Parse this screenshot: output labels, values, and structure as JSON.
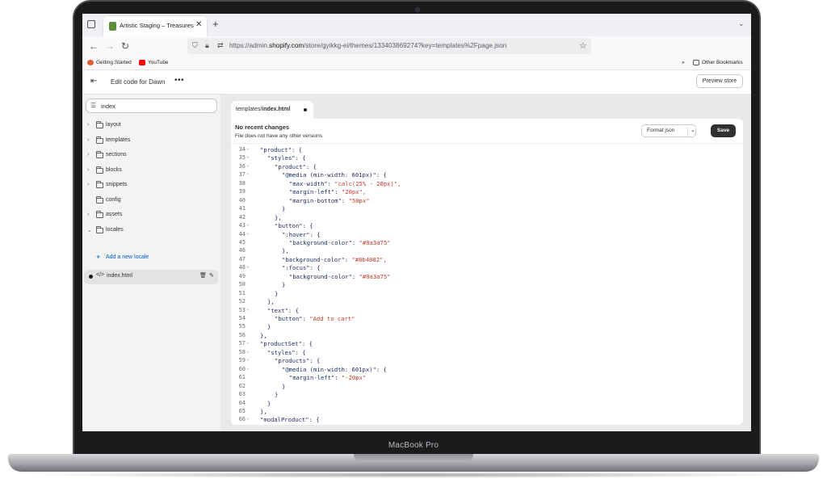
{
  "device": {
    "label": "MacBook Pro"
  },
  "browser": {
    "tab_title": "Artistic Staging – Treasures Stor",
    "url_prefix": "https://admin.",
    "url_host": "shopify.com",
    "url_path": "/store/gyikkg-ei/themes/133403869274?key=templates%2Fpage.json",
    "bookmarks": [
      "Getting Started",
      "YouTube"
    ],
    "other_bookmarks": "Other Bookmarks"
  },
  "header": {
    "title": "Edit code for Dawn",
    "preview_label": "Preview store"
  },
  "sidebar": {
    "search_value": "index",
    "items": [
      {
        "label": "layout",
        "expand": "›"
      },
      {
        "label": "templates",
        "expand": "›"
      },
      {
        "label": "sections",
        "expand": "›"
      },
      {
        "label": "blocks",
        "expand": "›"
      },
      {
        "label": "snippets",
        "expand": "›"
      },
      {
        "label": "config",
        "expand": ""
      },
      {
        "label": "assets",
        "expand": "›"
      },
      {
        "label": "locales",
        "expand": "⌄"
      }
    ],
    "add_locale": "Add a new locale",
    "open_file": "index.html"
  },
  "editor": {
    "tab_prefix": "templates/",
    "tab_file": "index.html",
    "status_title": "No recent changes",
    "status_sub": "File does not have any other versions",
    "format_label": "Format json",
    "save_label": "Save",
    "lines": [
      {
        "n": "34",
        "f": true,
        "t": "\"product\": {",
        "i": 1
      },
      {
        "n": "35",
        "f": true,
        "t": "\"styles\": {",
        "i": 2
      },
      {
        "n": "36",
        "f": true,
        "t": "\"product\": {",
        "i": 3
      },
      {
        "n": "37",
        "f": true,
        "t": "\"@media (min-width: 601px)\": {",
        "i": 4
      },
      {
        "n": "38",
        "f": false,
        "k": "\"max-width\": ",
        "v": "\"calc(25% - 20px)\",",
        "i": 5
      },
      {
        "n": "39",
        "f": false,
        "k": "\"margin-left\": ",
        "v": "\"20px\",",
        "i": 5
      },
      {
        "n": "40",
        "f": false,
        "k": "\"margin-bottom\": ",
        "v": "\"50px\"",
        "i": 5
      },
      {
        "n": "41",
        "f": false,
        "t": "}",
        "i": 4
      },
      {
        "n": "42",
        "f": false,
        "t": "},",
        "i": 3
      },
      {
        "n": "43",
        "f": true,
        "t": "\"button\": {",
        "i": 3
      },
      {
        "n": "44",
        "f": true,
        "t": "\":hover\": {",
        "i": 4
      },
      {
        "n": "45",
        "f": false,
        "k": "\"background-color\": ",
        "v": "\"#0a3a75\"",
        "i": 5
      },
      {
        "n": "46",
        "f": false,
        "t": "},",
        "i": 4
      },
      {
        "n": "47",
        "f": false,
        "k": "\"background-color\": ",
        "v": "\"#0b4082\",",
        "i": 4
      },
      {
        "n": "48",
        "f": true,
        "t": "\":focus\": {",
        "i": 4
      },
      {
        "n": "49",
        "f": false,
        "k": "\"background-color\": ",
        "v": "\"#0a3a75\"",
        "i": 5
      },
      {
        "n": "50",
        "f": false,
        "t": "}",
        "i": 4
      },
      {
        "n": "51",
        "f": false,
        "t": "}",
        "i": 3
      },
      {
        "n": "52",
        "f": false,
        "t": "},",
        "i": 2
      },
      {
        "n": "53",
        "f": true,
        "t": "\"text\": {",
        "i": 2
      },
      {
        "n": "54",
        "f": false,
        "k": "\"button\": ",
        "v": "\"Add to cart\"",
        "i": 3
      },
      {
        "n": "55",
        "f": false,
        "t": "}",
        "i": 2
      },
      {
        "n": "56",
        "f": false,
        "t": "},",
        "i": 1
      },
      {
        "n": "57",
        "f": true,
        "t": "\"productSet\": {",
        "i": 1
      },
      {
        "n": "58",
        "f": true,
        "t": "\"styles\": {",
        "i": 2
      },
      {
        "n": "59",
        "f": true,
        "t": "\"products\": {",
        "i": 3
      },
      {
        "n": "60",
        "f": true,
        "t": "\"@media (min-width: 601px)\": {",
        "i": 4
      },
      {
        "n": "61",
        "f": false,
        "k": "\"margin-left\": ",
        "v": "\"-20px\"",
        "i": 5
      },
      {
        "n": "62",
        "f": false,
        "t": "}",
        "i": 4
      },
      {
        "n": "63",
        "f": false,
        "t": "}",
        "i": 3
      },
      {
        "n": "64",
        "f": false,
        "t": "}",
        "i": 2
      },
      {
        "n": "65",
        "f": false,
        "t": "},",
        "i": 1
      },
      {
        "n": "66",
        "f": true,
        "t": "\"modalProduct\": {",
        "i": 1
      }
    ]
  },
  "colors": {
    "string": "#c0392b",
    "key": "#202a63",
    "accent": "#005bd3",
    "save_bg": "#303030"
  }
}
